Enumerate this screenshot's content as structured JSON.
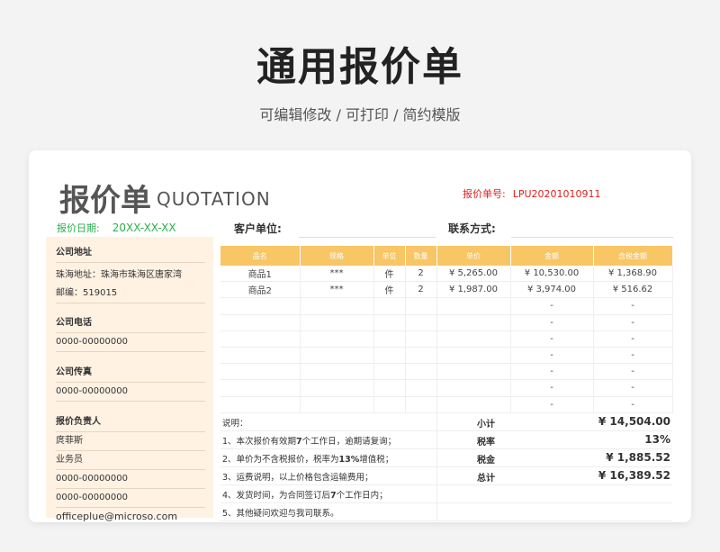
{
  "header": {
    "title": "通用报价单",
    "subtitle": "可编辑修改 /  可打印  /  简约模版"
  },
  "quotation": {
    "title_cn": "报价单",
    "title_en": "QUOTATION",
    "number_label": "报价单号:",
    "number_value": "LPU20201010911",
    "date_label": "报价日期:",
    "date_value": "20XX-XX-XX",
    "customer_label": "客户单位:",
    "contact_label": "联系方式:"
  },
  "sidebar": {
    "address_title": "公司地址",
    "address_line1": "珠海地址：珠海市珠海区唐家湾",
    "address_line2": "邮编：519015",
    "phone_title": "公司电话",
    "phone_value": "0000-00000000",
    "fax_title": "公司传真",
    "fax_value": "0000-00000000",
    "manager_title": "报价负责人",
    "manager_name": "庹菲斯",
    "manager_role": "业务员",
    "manager_phone1": "0000-00000000",
    "manager_phone2": "0000-00000000",
    "manager_email": "officeplue@microso.com"
  },
  "table": {
    "headers": [
      "品名",
      "规格",
      "单位",
      "数量",
      "单价",
      "金额",
      "含税金额"
    ],
    "rows": [
      [
        "商品1",
        "***",
        "件",
        "2",
        "¥ 5,265.00",
        "¥ 10,530.00",
        "¥ 1,368.90"
      ],
      [
        "商品2",
        "***",
        "件",
        "2",
        "¥ 1,987.00",
        "¥ 3,974.00",
        "¥ 516.62"
      ],
      [
        "",
        "",
        "",
        "",
        "",
        "-",
        "-"
      ],
      [
        "",
        "",
        "",
        "",
        "",
        "-",
        "-"
      ],
      [
        "",
        "",
        "",
        "",
        "",
        "-",
        "-"
      ],
      [
        "",
        "",
        "",
        "",
        "",
        "-",
        "-"
      ],
      [
        "",
        "",
        "",
        "",
        "",
        "-",
        "-"
      ],
      [
        "",
        "",
        "",
        "",
        "",
        "-",
        "-"
      ],
      [
        "",
        "",
        "",
        "",
        "",
        "-",
        "-"
      ]
    ]
  },
  "notes": {
    "title": "说明：",
    "n1_a": "1、本次报价有效期",
    "n1_b": "7",
    "n1_c": "个工作日，逾期请复询；",
    "n2_a": "2、单价为不含税报价，税率为",
    "n2_b": "13%",
    "n2_c": "增值税；",
    "n3": "3、运费说明，以上价格包含运输费用；",
    "n4_a": "4、发货时间，为合同签订后",
    "n4_b": "7",
    "n4_c": "个工作日内；",
    "n5": "5、其他疑问欢迎与我司联系。"
  },
  "summary": {
    "subtotal_label": "小计",
    "subtotal_value": "¥ 14,504.00",
    "taxrate_label": "税率",
    "taxrate_value": "13%",
    "tax_label": "税金",
    "tax_value": "¥ 1,885.52",
    "total_label": "总计",
    "total_value": "¥ 16,389.52"
  },
  "colors": {
    "accent": "#f8c665",
    "sidebar_bg": "#fff2e3",
    "number_red": "#e02020",
    "date_green": "#2bb04a"
  }
}
